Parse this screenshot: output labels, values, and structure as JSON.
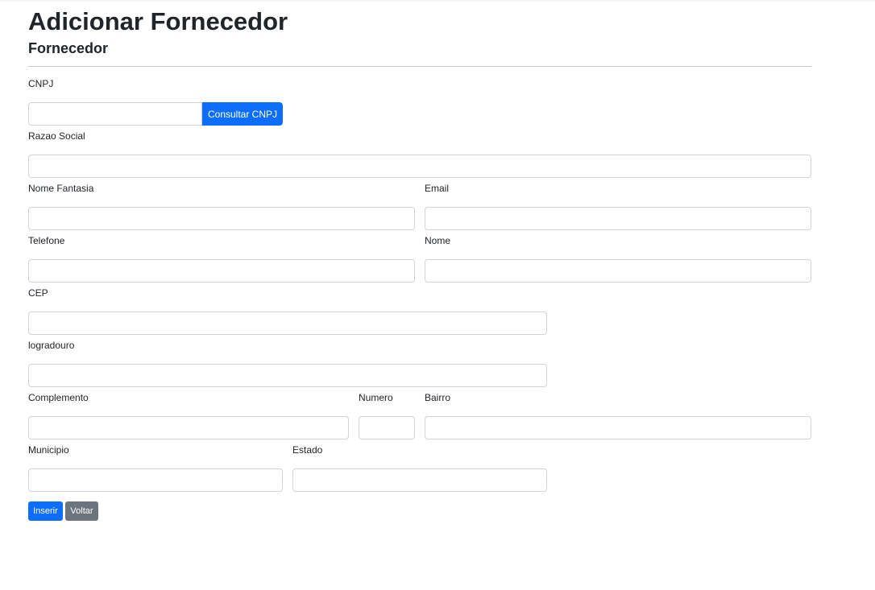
{
  "page": {
    "title": "Adicionar Fornecedor",
    "subtitle": "Fornecedor"
  },
  "form": {
    "cnpj": {
      "label": "CNPJ",
      "value": "",
      "button_label": "Consultar CNPJ"
    },
    "razao_social": {
      "label": "Razao Social",
      "value": ""
    },
    "nome_fantasia": {
      "label": "Nome Fantasia",
      "value": ""
    },
    "email": {
      "label": "Email",
      "value": ""
    },
    "telefone": {
      "label": "Telefone",
      "value": ""
    },
    "nome": {
      "label": "Nome",
      "value": ""
    },
    "cep": {
      "label": "CEP",
      "value": ""
    },
    "logradouro": {
      "label": "logradouro",
      "value": ""
    },
    "complemento": {
      "label": "Complemento",
      "value": ""
    },
    "numero": {
      "label": "Numero",
      "value": ""
    },
    "bairro": {
      "label": "Bairro",
      "value": ""
    },
    "municipio": {
      "label": "Municipio",
      "value": ""
    },
    "estado": {
      "label": "Estado",
      "value": ""
    }
  },
  "actions": {
    "insert_label": "Inserir",
    "back_label": "Voltar"
  },
  "colors": {
    "primary": "#0d6efd",
    "secondary": "#6c757d",
    "input_border": "#ced4da",
    "text": "#212529"
  }
}
